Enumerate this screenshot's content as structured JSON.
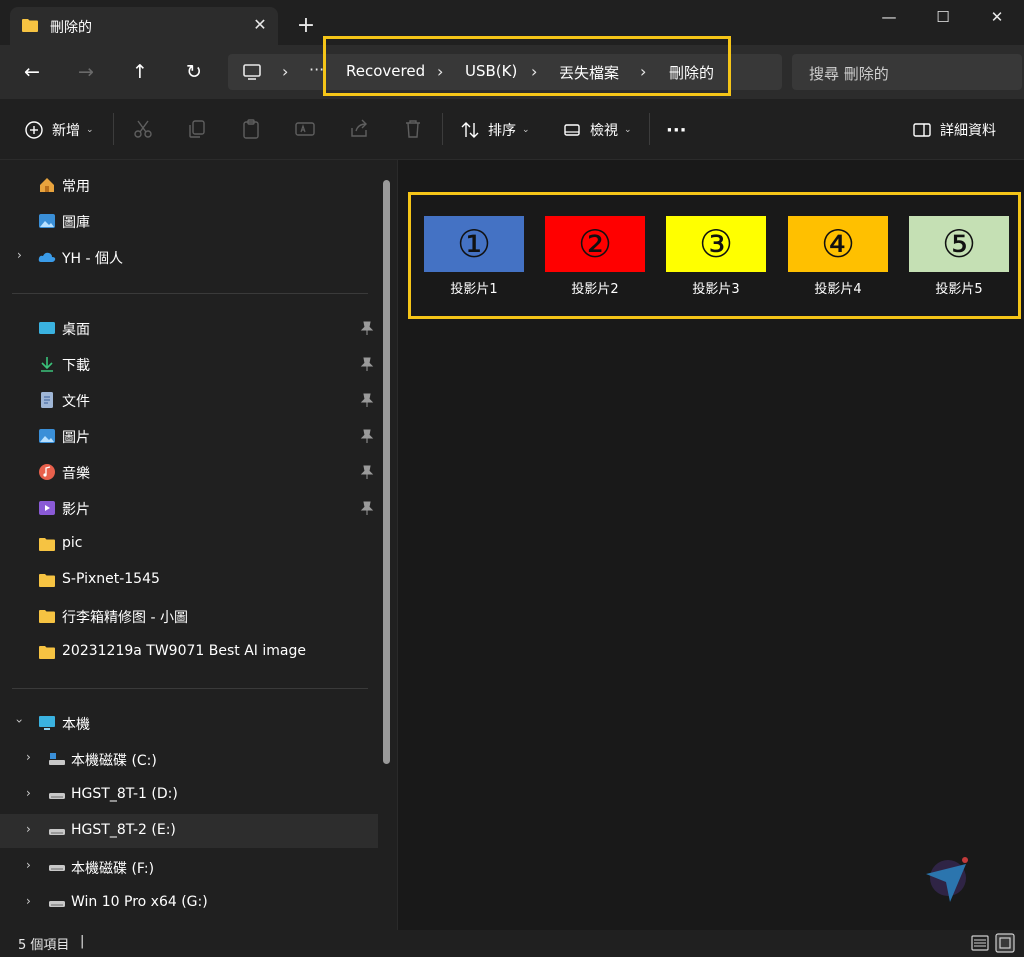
{
  "window": {
    "tab_title": "刪除的",
    "tab_close": "✕",
    "new_tab": "+",
    "minimize": "—",
    "maximize": "☐",
    "close": "✕"
  },
  "address": {
    "back": "←",
    "forward": "→",
    "up": "↑",
    "refresh": "↻",
    "more": "···",
    "separator": "›",
    "crumbs": [
      "Recovered",
      "USB(K)",
      "丟失檔案",
      "刪除的"
    ],
    "search_placeholder": "搜尋 刪除的"
  },
  "toolbar": {
    "new_label": "新增",
    "sort_label": "排序",
    "view_label": "檢視",
    "more_label": "···",
    "details_label": "詳細資料",
    "dropdown": "⌄"
  },
  "sidebar": {
    "quick": [
      {
        "label": "常用",
        "icon": "home-icon"
      },
      {
        "label": "圖庫",
        "icon": "gallery-icon"
      },
      {
        "label": "YH - 個人",
        "icon": "onedrive-icon"
      }
    ],
    "pinned": [
      {
        "label": "桌面",
        "icon": "desktop-icon"
      },
      {
        "label": "下載",
        "icon": "download-icon"
      },
      {
        "label": "文件",
        "icon": "documents-icon"
      },
      {
        "label": "圖片",
        "icon": "pictures-icon"
      },
      {
        "label": "音樂",
        "icon": "music-icon"
      },
      {
        "label": "影片",
        "icon": "videos-icon"
      }
    ],
    "folders": [
      {
        "label": "pic"
      },
      {
        "label": "S-Pixnet-1545"
      },
      {
        "label": "行李箱精修图 - 小圖"
      },
      {
        "label": "20231219a TW9071 Best AI image"
      }
    ],
    "this_pc": "本機",
    "drives": [
      {
        "label": "本機磁碟 (C:)"
      },
      {
        "label": "HGST_8T-1 (D:)"
      },
      {
        "label": "HGST_8T-2 (E:)"
      },
      {
        "label": "本機磁碟 (F:)"
      },
      {
        "label": "Win 10 Pro x64 (G:)"
      }
    ]
  },
  "files": [
    {
      "name": "投影片1",
      "symbol": "①",
      "color": "#4472c4"
    },
    {
      "name": "投影片2",
      "symbol": "②",
      "color": "#ff0000"
    },
    {
      "name": "投影片3",
      "symbol": "③",
      "color": "#ffff00"
    },
    {
      "name": "投影片4",
      "symbol": "④",
      "color": "#ffc000"
    },
    {
      "name": "投影片5",
      "symbol": "⑤",
      "color": "#c5e0b4"
    }
  ],
  "status": {
    "item_count": "5 個項目",
    "caret": "|"
  },
  "colors": {
    "highlight": "#f5c518",
    "folder": "#f6c342"
  }
}
